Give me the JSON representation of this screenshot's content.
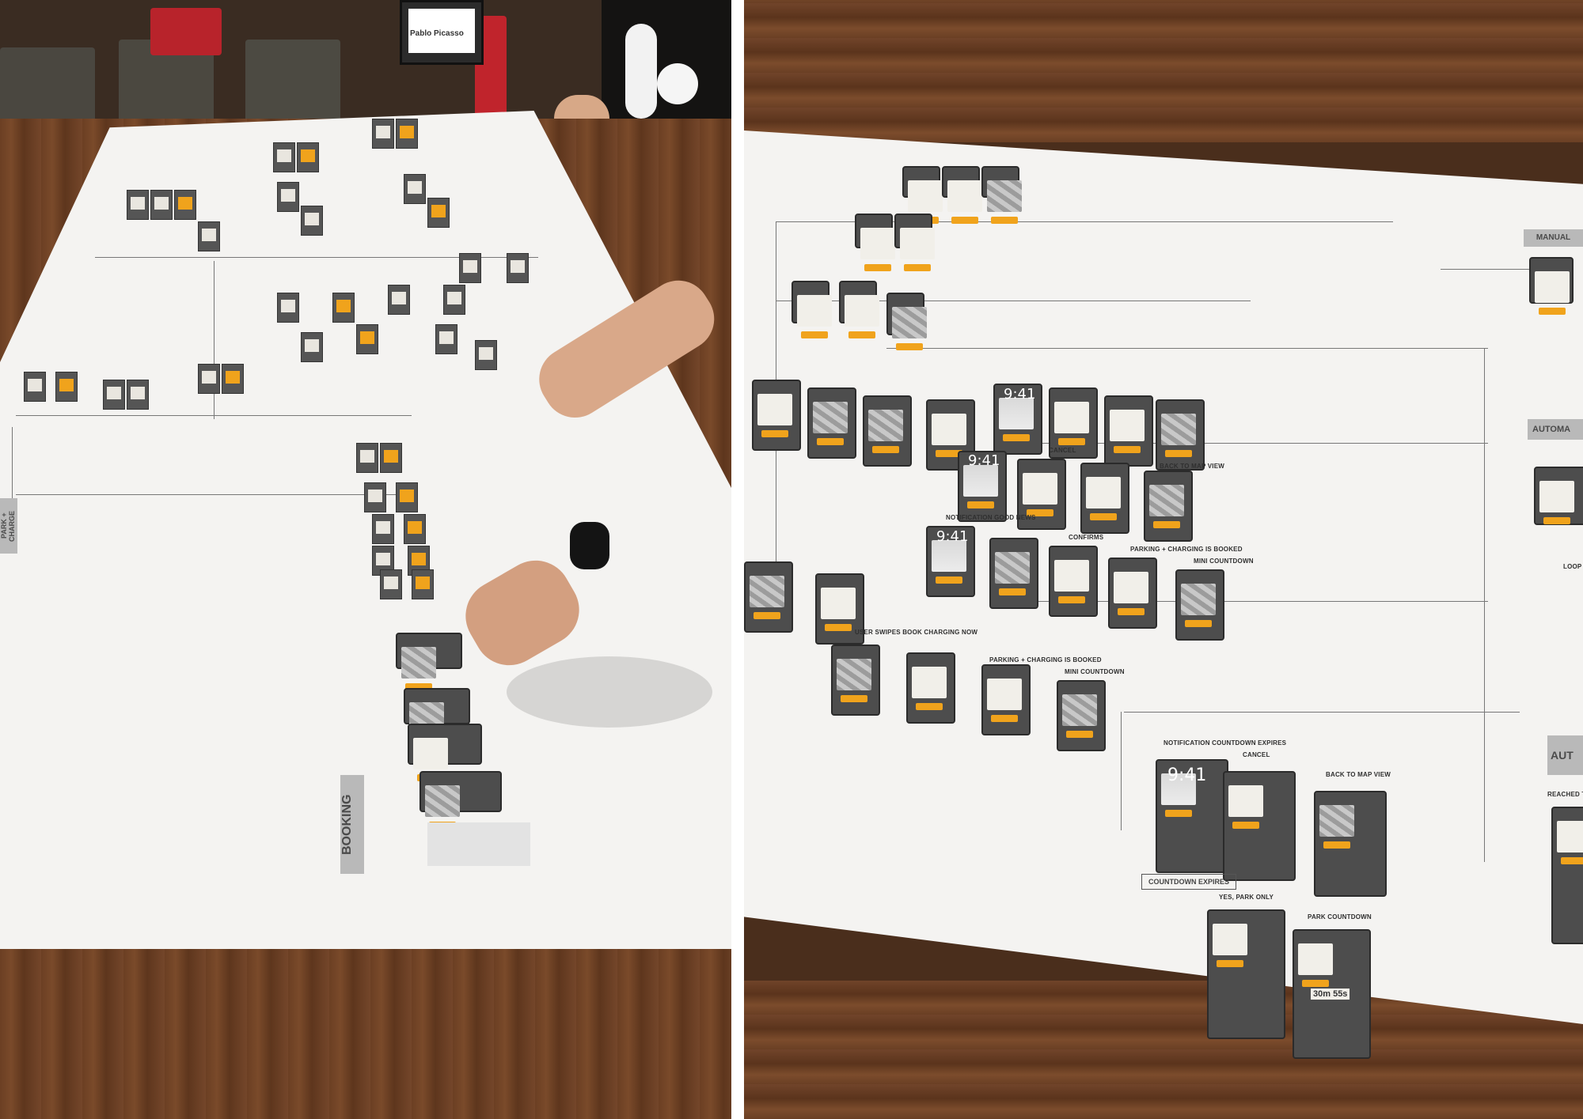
{
  "left_photo": {
    "poster": "Pablo Picasso",
    "section_labels": [
      "BOOKING",
      "PARK + CHARGE"
    ]
  },
  "right_photo": {
    "screens": {
      "notification_countdown_expires": "NOTIFICATION COUNTDOWN EXPIRES",
      "cancel": "CANCEL",
      "back_to_map_view": "BACK TO MAP VIEW",
      "yes_park_only": "YES, PARK ONLY",
      "park_countdown": "PARK COUNTDOWN",
      "countdown_expires": "COUNTDOWN EXPIRES",
      "user_swipes_book_charging_now": "USER SWIPES BOOK CHARGING NOW",
      "parking_charging_booked": "PARKING + CHARGING IS BOOKED",
      "mini_countdown": "MINI COUNTDOWN",
      "notification_good_news": "NOTIFICATION GOOD NEWS",
      "confirms": "CONFIRMS",
      "manual": "MANUAL",
      "automa": "AUTOMA",
      "aut": "AUT",
      "loop": "LOOP",
      "reached": "REACHED T"
    },
    "clock_times": [
      "9:41",
      "9:41",
      "9:41",
      "9:41"
    ],
    "countdown_value": "30m 55s"
  },
  "colors": {
    "accent": "#f0a31c",
    "paper": "#f4f3f1",
    "wood": "#6b3f23",
    "phone": "#4d4d4d"
  }
}
